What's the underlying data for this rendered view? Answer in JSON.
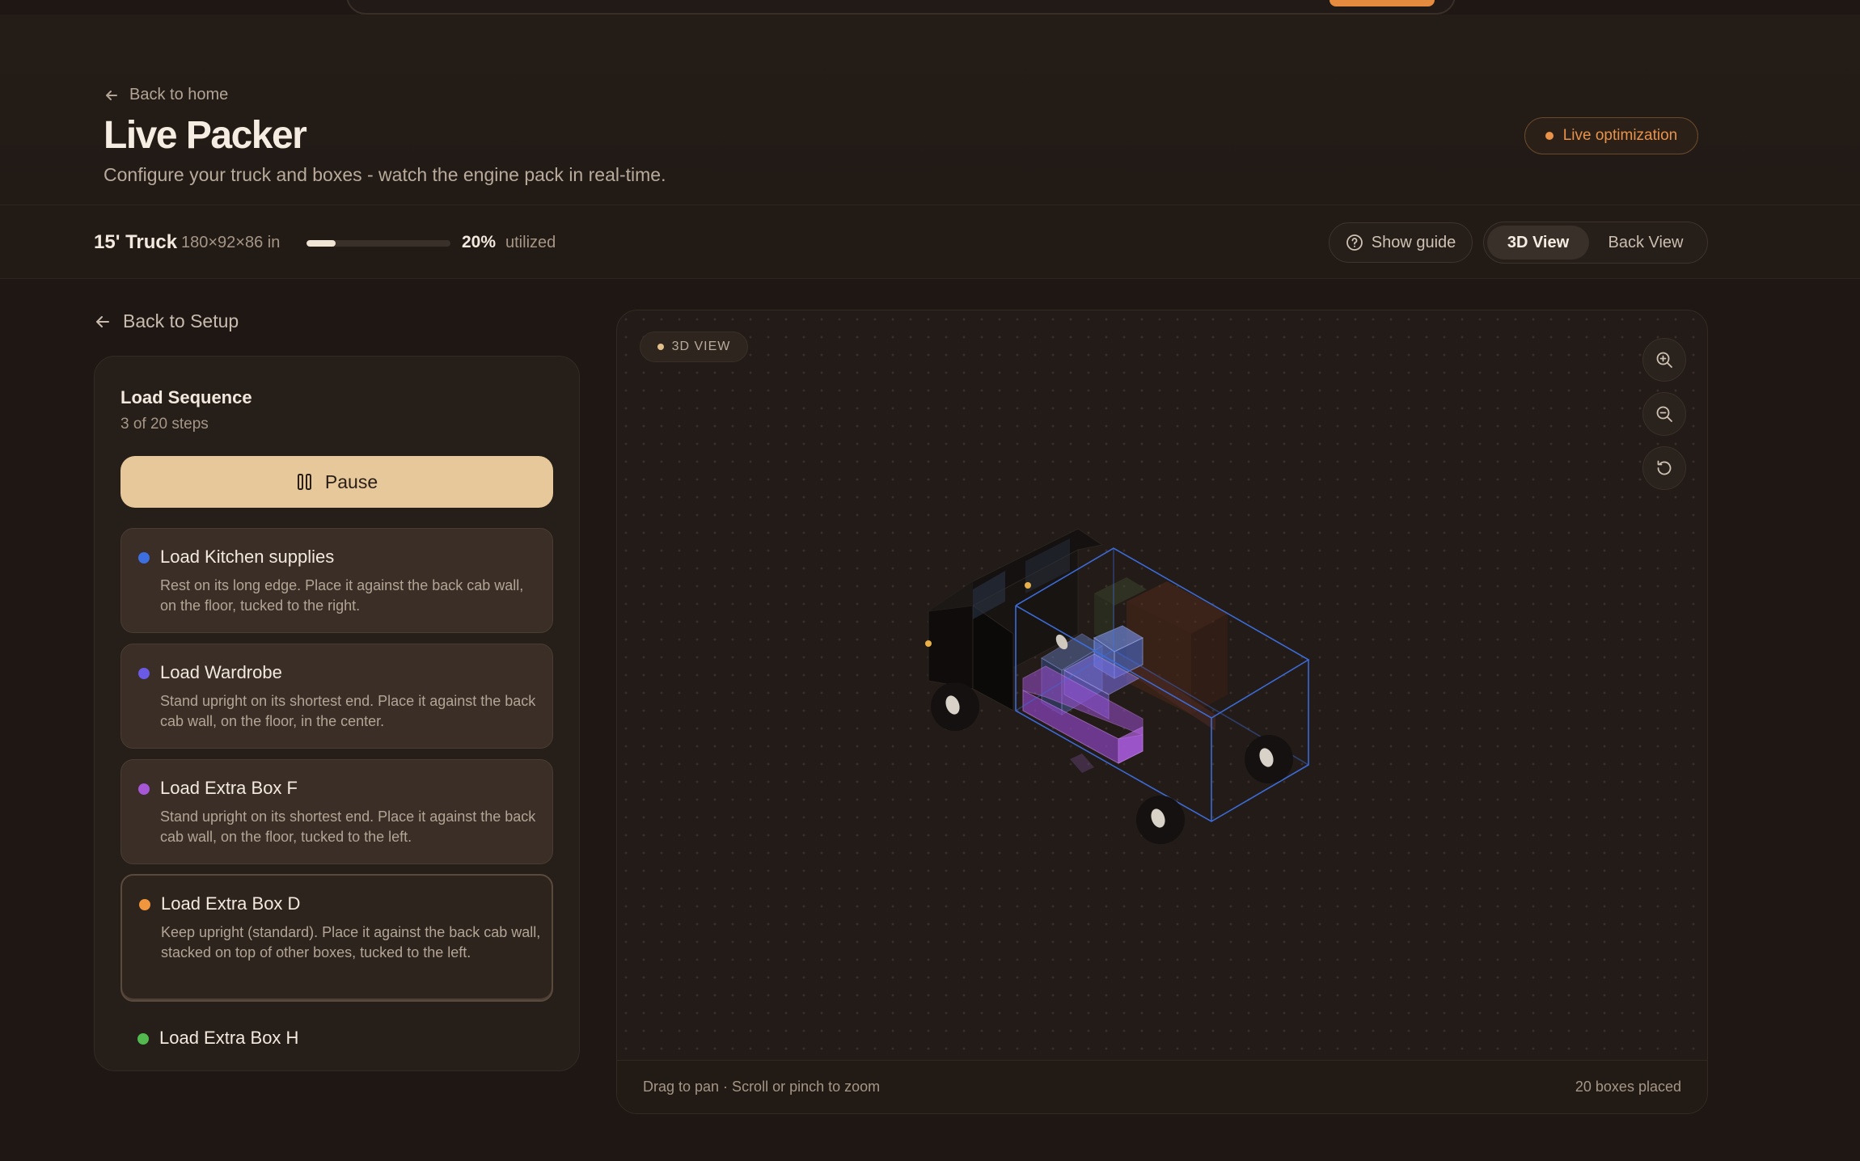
{
  "header": {
    "back_label": "Back to home",
    "title": "Live Packer",
    "subtitle": "Configure your truck and boxes - watch the engine pack in real-time.",
    "badge": "Live optimization"
  },
  "status": {
    "truck_name": "15' Truck",
    "truck_dims": "180×92×86 in",
    "utilization_value": 0.2,
    "utilization_pct": "20%",
    "utilization_label": "utilized",
    "guide_label": "Show guide",
    "views": [
      "3D View",
      "Back View"
    ],
    "active_view": "3D View"
  },
  "sidebar": {
    "back_label": "Back to Setup",
    "title": "Load Sequence",
    "steps_text": "3 of 20 steps",
    "pause_label": "Pause",
    "steps": [
      {
        "title": "Load Kitchen supplies",
        "desc": "Rest on its long edge. Place it against the back cab wall, on the floor, tucked to the right.",
        "color": "#3d6fe0"
      },
      {
        "title": "Load Wardrobe",
        "desc": "Stand upright on its shortest end. Place it against the back cab wall, on the floor, in the center.",
        "color": "#6a5ae6"
      },
      {
        "title": "Load Extra Box F",
        "desc": "Stand upright on its shortest end. Place it against the back cab wall, on the floor, tucked to the left.",
        "color": "#a557d6"
      },
      {
        "title": "Load Extra Box D",
        "desc": "Keep upright (standard). Place it against the back cab wall, stacked on top of other boxes, tucked to the left.",
        "color": "#f0963e"
      },
      {
        "title": "Load Extra Box H",
        "desc": "",
        "color": "#52b84f"
      }
    ]
  },
  "viewport": {
    "badge": "3D VIEW",
    "hint": "Drag to pan · Scroll or pinch to zoom",
    "count": "20 boxes placed"
  },
  "colors": {
    "accent": "#e9924a",
    "pause_bg": "#e6c89a",
    "truck_outline": "#3d6fe0"
  }
}
